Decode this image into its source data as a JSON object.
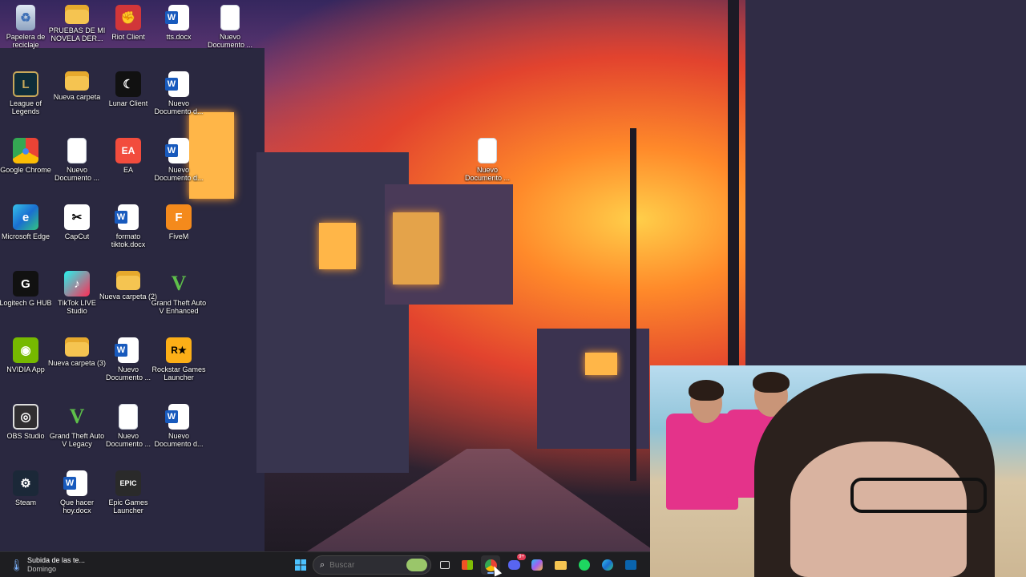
{
  "desktop": {
    "icons": [
      {
        "label": "Papelera de reciclaje",
        "icon": "recycle-bin-icon"
      },
      {
        "label": "PRUEBAS DE MI NOVELA DER...",
        "icon": "folder-icon"
      },
      {
        "label": "Riot Client",
        "icon": "riot-client-icon"
      },
      {
        "label": "tts.docx",
        "icon": "word-doc-icon"
      },
      {
        "label": "Nuevo Documento ...",
        "icon": "text-doc-icon"
      },
      {
        "label": "League of Legends",
        "icon": "league-icon"
      },
      {
        "label": "Nueva carpeta",
        "icon": "folder-icon"
      },
      {
        "label": "Lunar Client",
        "icon": "lunar-client-icon"
      },
      {
        "label": "Nuevo Documento d...",
        "icon": "word-doc-icon"
      },
      {
        "label": "Google Chrome",
        "icon": "chrome-icon"
      },
      {
        "label": "Nuevo Documento ...",
        "icon": "text-doc-icon"
      },
      {
        "label": "EA",
        "icon": "ea-icon"
      },
      {
        "label": "Nuevo Documento d...",
        "icon": "word-doc-icon"
      },
      {
        "label": "Nuevo Documento ...",
        "icon": "text-doc-icon"
      },
      {
        "label": "Microsoft Edge",
        "icon": "edge-icon"
      },
      {
        "label": "CapCut",
        "icon": "capcut-icon"
      },
      {
        "label": "formato tiktok.docx",
        "icon": "word-doc-icon"
      },
      {
        "label": "FiveM",
        "icon": "fivem-icon"
      },
      {
        "label": "Logitech G HUB",
        "icon": "logitech-icon"
      },
      {
        "label": "TikTok LIVE Studio",
        "icon": "tiktok-icon"
      },
      {
        "label": "Nueva carpeta (2)",
        "icon": "folder-icon"
      },
      {
        "label": "Grand Theft Auto V Enhanced",
        "icon": "gta-icon"
      },
      {
        "label": "NVIDIA App",
        "icon": "nvidia-icon"
      },
      {
        "label": "Nueva carpeta (3)",
        "icon": "folder-icon"
      },
      {
        "label": "Nuevo Documento ...",
        "icon": "word-doc-icon"
      },
      {
        "label": "Rockstar Games Launcher",
        "icon": "rockstar-icon"
      },
      {
        "label": "OBS Studio",
        "icon": "obs-icon"
      },
      {
        "label": "Grand Theft Auto V Legacy",
        "icon": "gta-icon"
      },
      {
        "label": "Nuevo Documento ...",
        "icon": "text-doc-icon"
      },
      {
        "label": "Nuevo Documento d...",
        "icon": "word-doc-icon"
      },
      {
        "label": "Steam",
        "icon": "steam-icon"
      },
      {
        "label": "Que hacer hoy.docx",
        "icon": "word-doc-icon"
      },
      {
        "label": "Epic Games Launcher",
        "icon": "epic-games-icon"
      }
    ],
    "glyphs": {
      "riot": "✊",
      "league": "L",
      "lunar": "☾",
      "chrome": "●",
      "ea": "EA",
      "edge": "e",
      "capcut": "✂",
      "fivem": "F",
      "logitech": "G",
      "tiktok": "♪",
      "gta": "V",
      "nvidia": "◉",
      "rockstar": "R★",
      "obs": "◎",
      "steam": "⚙",
      "epic": "EPIC"
    }
  },
  "taskbar": {
    "weather": {
      "text": "Subida de las te...",
      "day": "Domingo"
    },
    "search_placeholder": "Buscar",
    "notification_badge": "9+",
    "colors": {
      "accent": "#7fb2ff",
      "taskbar_bg": "#1e1e22"
    }
  }
}
